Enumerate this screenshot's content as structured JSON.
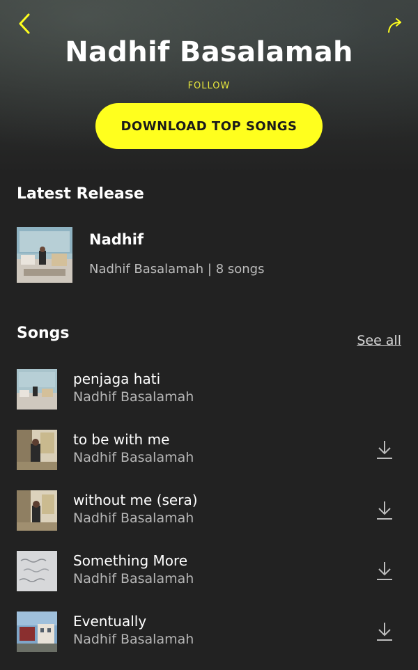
{
  "header": {
    "artist_name": "Nadhif Basalamah",
    "follow_label": "FOLLOW",
    "download_label": "DOWNLOAD TOP SONGS",
    "back_icon": "chevron-left-icon",
    "share_icon": "share-arrow-icon"
  },
  "latest_release": {
    "section_title": "Latest Release",
    "album_title": "Nadhif",
    "meta": "Nadhif Basalamah | 8 songs"
  },
  "songs": {
    "section_title": "Songs",
    "see_all_label": "See all",
    "items": [
      {
        "title": "penjaga hati",
        "artist": "Nadhif Basalamah",
        "downloadable": false
      },
      {
        "title": "to be with me",
        "artist": "Nadhif Basalamah",
        "downloadable": true
      },
      {
        "title": "without me (sera)",
        "artist": "Nadhif Basalamah",
        "downloadable": true
      },
      {
        "title": "Something More",
        "artist": "Nadhif Basalamah",
        "downloadable": true
      },
      {
        "title": "Eventually",
        "artist": "Nadhif Basalamah",
        "downloadable": true
      }
    ]
  },
  "colors": {
    "background": "#222222",
    "accent_yellow": "#ffff1e",
    "follow_yellow": "#e6e63c",
    "secondary_text": "#b7b7b7"
  }
}
